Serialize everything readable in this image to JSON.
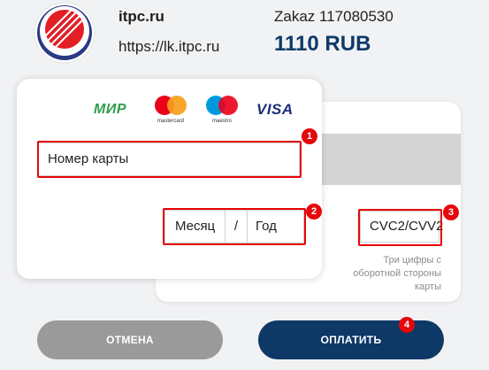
{
  "merchant": {
    "name": "itpc.ru",
    "url": "https://lk.itpc.ru"
  },
  "order": {
    "number_text": "Zakaz 117080530",
    "amount": "1110 RUB"
  },
  "card_front": {
    "brands": [
      "МИР",
      "mastercard",
      "maestro",
      "VISA"
    ],
    "card_number_placeholder": "Номер карты",
    "month_placeholder": "Месяц",
    "separator": "/",
    "year_placeholder": "Год"
  },
  "card_back": {
    "cvc_placeholder": "CVC2/CVV2",
    "cvc_hint": "Три цифры с оборотной стороны карты"
  },
  "markers": [
    "1",
    "2",
    "3",
    "4"
  ],
  "buttons": {
    "cancel": "ОТМЕНА",
    "pay": "ОПЛАТИТЬ"
  },
  "colors": {
    "accent_red": "#e5070b",
    "pay_button": "#0e3866",
    "cancel_button": "#9a9a9a",
    "amount_text": "#0d3a68",
    "mir_green": "#2e9d4d",
    "visa_blue": "#1a2f7a",
    "mastercard_red": "#eb001b",
    "mastercard_yellow": "#f79e1b",
    "maestro_blue": "#0099df"
  }
}
